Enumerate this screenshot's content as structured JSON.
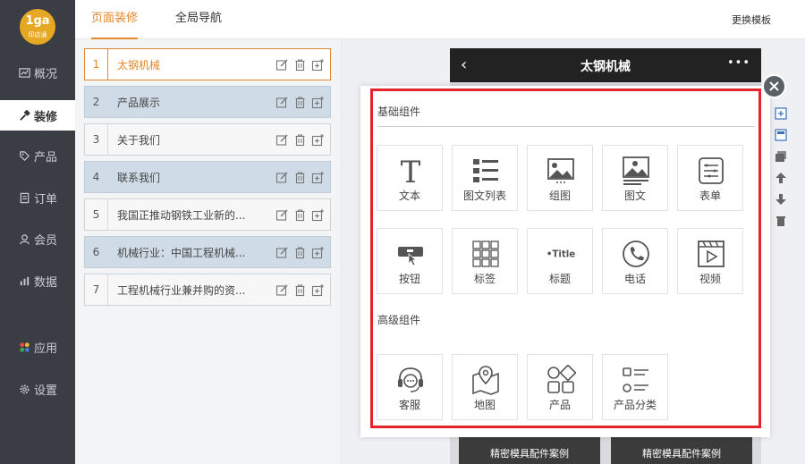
{
  "logo": {
    "line1": "1ga",
    "line2": "印店通"
  },
  "sidebar": {
    "items": [
      {
        "label": "概况",
        "icon": "chart-icon"
      },
      {
        "label": "装修",
        "icon": "hammer-icon",
        "active": true
      },
      {
        "label": "产品",
        "icon": "tag-icon"
      },
      {
        "label": "订单",
        "icon": "document-icon"
      },
      {
        "label": "会员",
        "icon": "user-icon"
      },
      {
        "label": "数据",
        "icon": "bar-chart-icon"
      },
      {
        "label": "应用",
        "icon": "apps-icon"
      },
      {
        "label": "设置",
        "icon": "gear-icon"
      }
    ]
  },
  "header": {
    "tabs": [
      {
        "label": "页面装修",
        "active": true
      },
      {
        "label": "全局导航"
      }
    ],
    "change_template": "更换模板"
  },
  "pages": [
    {
      "num": "1",
      "title": "太钢机械",
      "selected": true
    },
    {
      "num": "2",
      "title": "产品展示"
    },
    {
      "num": "3",
      "title": "关于我们"
    },
    {
      "num": "4",
      "title": "联系我们"
    },
    {
      "num": "5",
      "title": "我国正推动钢铁工业新的..."
    },
    {
      "num": "6",
      "title": "机械行业：中国工程机械..."
    },
    {
      "num": "7",
      "title": "工程机械行业兼并购的资..."
    }
  ],
  "preview": {
    "back": "‹",
    "title": "太钢机械",
    "more": "•••",
    "case_left": "精密模具配件案例",
    "case_right": "精密模具配件案例"
  },
  "modal": {
    "basic_title": "基础组件",
    "advanced_title": "高级组件",
    "basic": [
      {
        "label": "文本",
        "icon": "text-icon"
      },
      {
        "label": "图文列表",
        "icon": "image-list-icon"
      },
      {
        "label": "组图",
        "icon": "image-group-icon"
      },
      {
        "label": "图文",
        "icon": "image-text-icon"
      },
      {
        "label": "表单",
        "icon": "form-icon"
      },
      {
        "label": "按钮",
        "icon": "button-icon"
      },
      {
        "label": "标签",
        "icon": "tags-icon"
      },
      {
        "label": "标题",
        "icon": "title-icon",
        "glyph": "•Title"
      },
      {
        "label": "电话",
        "icon": "phone-icon"
      },
      {
        "label": "视频",
        "icon": "video-icon"
      }
    ],
    "advanced": [
      {
        "label": "客服",
        "icon": "headset-icon"
      },
      {
        "label": "地图",
        "icon": "map-icon"
      },
      {
        "label": "产品",
        "icon": "product-icon"
      },
      {
        "label": "产品分类",
        "icon": "category-icon"
      }
    ]
  },
  "colors": {
    "accent": "#e0892d",
    "sidebar": "#3a3e44",
    "highlight": "#e5232a"
  }
}
